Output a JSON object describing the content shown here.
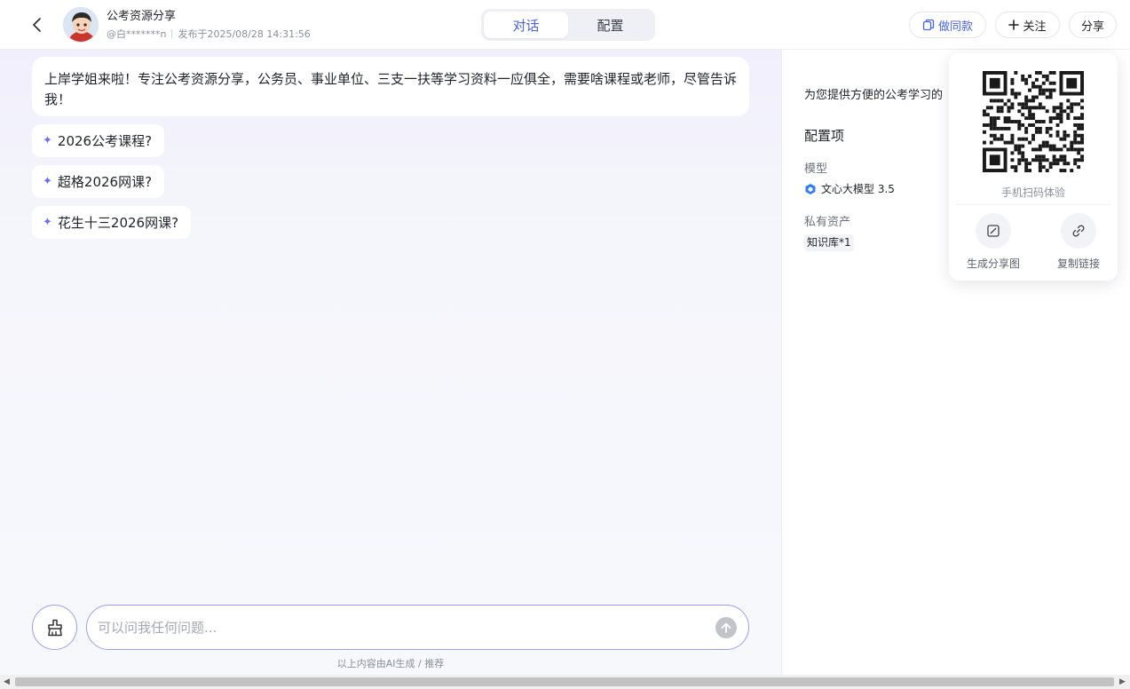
{
  "header": {
    "app_title": "公考资源分享",
    "author": "@白*******n",
    "published": "发布于2025/08/28 14:31:56",
    "tabs": [
      {
        "label": "对话",
        "active": true
      },
      {
        "label": "配置",
        "active": false
      }
    ],
    "clone_label": "做同款",
    "follow_label": "关注",
    "share_label": "分享"
  },
  "chat": {
    "welcome": "上岸学姐来啦！专注公考资源分享，公务员、事业单位、三支一扶等学习资料一应俱全，需要啥课程或老师，尽管告诉我！",
    "suggestions": [
      "2026公考课程?",
      "超格2026网课?",
      "花生十三2026网课?"
    ],
    "input_placeholder": "可以问我任何问题...",
    "footnote": "以上内容由AI生成 / 推荐"
  },
  "config": {
    "description": "为您提供方便的公考学习的",
    "section_title": "配置项",
    "model_label": "模型",
    "model_value": "文心大模型 3.5",
    "assets_label": "私有资产",
    "knowledge_base": "知识库*1"
  },
  "share_popover": {
    "qr_caption": "手机扫码体验",
    "actions": [
      {
        "label": "生成分享图",
        "icon": "image-icon"
      },
      {
        "label": "复制链接",
        "icon": "link-icon"
      }
    ]
  },
  "colors": {
    "accent": "#4a63f0",
    "sparkle": "#6b6ff0",
    "input_border": "#9c9bf0"
  }
}
